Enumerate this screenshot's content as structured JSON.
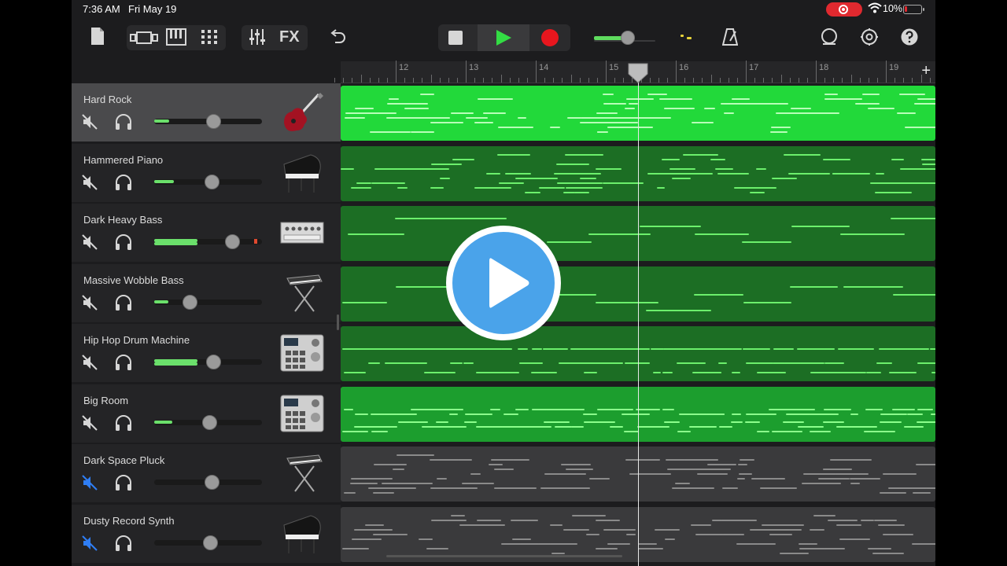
{
  "status_bar": {
    "time": "7:36 AM",
    "date": "Fri May 19",
    "battery_percent": "10%"
  },
  "toolbar": {
    "fx_label": "FX",
    "icons": [
      "document-icon",
      "tracks-view-icon",
      "piano-keys-icon",
      "grid-icon",
      "mixer-icon",
      "undo-icon",
      "stop-icon",
      "play-icon",
      "record-icon",
      "metronome-icon",
      "loop-icon",
      "settings-icon",
      "help-icon"
    ],
    "master_volume": 0.55
  },
  "ruler": {
    "bars": [
      "12",
      "13",
      "14",
      "15",
      "16",
      "17",
      "18",
      "19"
    ],
    "add_label": "+"
  },
  "tracks": [
    {
      "name": "Hard Rock",
      "volume": 0.55,
      "fill": 0.14,
      "muted": false,
      "selected": true,
      "instrument": "electric-guitar-icon",
      "region_color": "#22d93a",
      "note_color": "#b8ffb8"
    },
    {
      "name": "Hammered Piano",
      "volume": 0.53,
      "fill": 0.18,
      "muted": false,
      "selected": false,
      "instrument": "grand-piano-icon",
      "region_color": "#1c6e24",
      "note_color": "#6cf06c"
    },
    {
      "name": "Dark Heavy Bass",
      "volume": 0.72,
      "fill": 0.4,
      "muted": false,
      "selected": false,
      "instrument": "synth-module-icon",
      "region_color": "#1c6e24",
      "note_color": "#6cf06c"
    },
    {
      "name": "Massive Wobble Bass",
      "volume": 0.33,
      "fill": 0.13,
      "muted": false,
      "selected": false,
      "instrument": "keyboard-stand-icon",
      "region_color": "#1c6e24",
      "note_color": "#6cf06c"
    },
    {
      "name": "Hip Hop Drum Machine",
      "volume": 0.55,
      "fill": 0.4,
      "muted": false,
      "selected": false,
      "instrument": "drum-machine-icon",
      "region_color": "#1c6e24",
      "note_color": "#6cf06c"
    },
    {
      "name": "Big Room",
      "volume": 0.51,
      "fill": 0.17,
      "muted": false,
      "selected": false,
      "instrument": "drum-machine-icon",
      "region_color": "#1c9e2e",
      "note_color": "#8cff8c"
    },
    {
      "name": "Dark Space Pluck",
      "volume": 0.53,
      "fill": 0.0,
      "muted": true,
      "selected": false,
      "instrument": "keyboard-stand-icon",
      "region_color": "#3a3a3c",
      "note_color": "#8a8a8a"
    },
    {
      "name": "Dusty Record Synth",
      "volume": 0.52,
      "fill": 0.0,
      "muted": true,
      "selected": false,
      "instrument": "grand-piano-icon",
      "region_color": "#3a3a3c",
      "note_color": "#8a8a8a"
    }
  ],
  "accent": {
    "green": "#33dd44",
    "blue": "#4aa3ea",
    "red": "#e0292f"
  }
}
